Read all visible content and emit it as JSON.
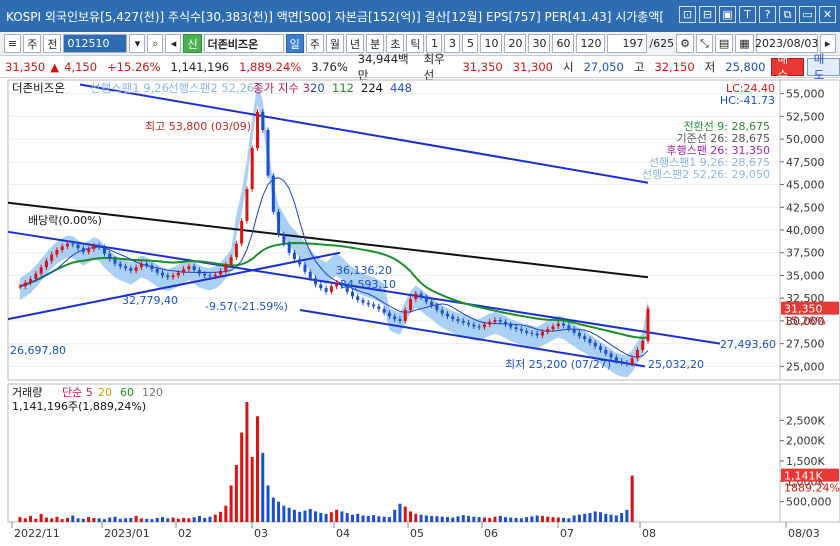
{
  "titlebar": {
    "text": "KOSPI 외국인보유[5,427(천)] 주식수[30,383(천)] 액면[500] 자본금[152(억)] 결산[12월] EPS[757] PER[41.43] 시가총액[",
    "buttons": [
      "⊡",
      "⊟",
      "▣",
      "T",
      "?",
      "⧉",
      "▭",
      "✕"
    ]
  },
  "toolbar": {
    "menu_btn": "≡",
    "type_select": "주",
    "prev_label": "전",
    "code": "012510",
    "new_label": "신",
    "name": "더존비즈온",
    "periods": [
      "일",
      "주",
      "월",
      "년",
      "분",
      "초",
      "틱"
    ],
    "selected_period": "일",
    "intervals": [
      "1",
      "3",
      "5",
      "10",
      "20",
      "30",
      "60",
      "120"
    ],
    "count": "197",
    "total": "/625",
    "date": "2023/08/03"
  },
  "quote": {
    "price": "31,350",
    "arrow": "▲",
    "change": "4,150",
    "change_pct": "+15.26%",
    "volume": "1,141,196",
    "volume_ratio": "1,889.24%",
    "turnover": "3.76%",
    "amount": "34,944백만",
    "best_ask_label": "최우선",
    "best_ask": "31,350",
    "best_bid": "31,300",
    "open_label": "시",
    "open": "27,050",
    "high_label": "고",
    "high": "32,150",
    "low_label": "저",
    "low": "25,800",
    "buy_label": "매수",
    "sell_label": "매도"
  },
  "chart_data": {
    "type": "line",
    "title": "더존비즈온",
    "legend_top": [
      {
        "name": "선행스팬1 9,26",
        "color": "#8ab6e8"
      },
      {
        "name": "선행스팬2 52,26",
        "color": "#8ab6e8"
      },
      {
        "name": "종가 지수 3",
        "color": "#c2185b"
      },
      {
        "name": "20",
        "color": "#1f3fd6"
      },
      {
        "name": "112",
        "color": "#1a8f2a"
      },
      {
        "name": "224",
        "color": "#111"
      },
      {
        "name": "448",
        "color": "#2a4ad8"
      }
    ],
    "ichimoku_legend": [
      {
        "text": "전환선 9: 28,675",
        "color": "#2a8a3c"
      },
      {
        "text": "기준선 26: 28,675",
        "color": "#555"
      },
      {
        "text": "후행스팬 26: 31,350",
        "color": "#9c27b0"
      },
      {
        "text": "선행스팬1 9,26: 28,675",
        "color": "#8ab6e8"
      },
      {
        "text": "선행스팬2 52,26: 29,050",
        "color": "#8ab6e8"
      }
    ],
    "lc_label": "LC:24.40",
    "hc_label": "HC:-41.73",
    "y_ticks": [
      "55,000",
      "52,500",
      "50,000",
      "47,500",
      "45,000",
      "42,500",
      "40,000",
      "37,500",
      "35,000",
      "32,500",
      "30,000",
      "27,500",
      "25,000"
    ],
    "ylim": [
      23500,
      56500
    ],
    "current_price_tag": "31,350",
    "current_pct_tag": "15.26%",
    "x_labels": [
      "2022/11",
      "2023/01",
      "02",
      "03",
      "04",
      "05",
      "06",
      "07",
      "08",
      "08/03"
    ],
    "annotations": {
      "high": "최고 53,800 (03/09)",
      "low": "최저 25,200 (07/27)",
      "dividend": "배당락(0.00%)",
      "a1": "32,779,40",
      "a2": "26,697,80",
      "a3": "-9.57(-21.59%)",
      "a4": "36,136,20",
      "a5": "34,593,10",
      "a6": "27,493,60",
      "a7": "25,032,20"
    },
    "closes": [
      33800,
      34200,
      34600,
      35200,
      35900,
      36600,
      37300,
      37800,
      38200,
      38500,
      38400,
      38000,
      37600,
      37900,
      38300,
      38100,
      37400,
      36800,
      36300,
      36000,
      35800,
      35500,
      35900,
      36300,
      36100,
      35700,
      35300,
      35000,
      34800,
      35000,
      35300,
      35700,
      36000,
      35600,
      35200,
      35000,
      34900,
      35100,
      35500,
      36200,
      37000,
      38500,
      41000,
      44500,
      49000,
      53000,
      51000,
      46000,
      42000,
      39500,
      38500,
      37500,
      36800,
      36200,
      35400,
      34700,
      34000,
      33600,
      33200,
      33800,
      34200,
      33800,
      33200,
      32700,
      32300,
      32000,
      31800,
      31600,
      31300,
      30900,
      30500,
      30200,
      30000,
      31200,
      32400,
      33000,
      32600,
      32100,
      31700,
      31200,
      30800,
      30500,
      30200,
      30000,
      29800,
      29600,
      29400,
      29300,
      29600,
      29900,
      30100,
      29900,
      29600,
      29300,
      29100,
      28900,
      28700,
      28600,
      28400,
      28800,
      29100,
      29400,
      29700,
      29500,
      29100,
      28700,
      28300,
      28000,
      27600,
      27200,
      26800,
      26400,
      26000,
      25600,
      25400,
      25300,
      25900,
      26800,
      27800,
      31350
    ],
    "volume": {
      "title": "거래량",
      "legend": [
        {
          "name": "단순 5",
          "color": "#c2185b"
        },
        {
          "name": "20",
          "color": "#c9a400"
        },
        {
          "name": "60",
          "color": "#1a8f2a"
        },
        {
          "name": "120",
          "color": "#777"
        }
      ],
      "current": "1,141,196주(1,889,24%)",
      "y_ticks": [
        "2,500K",
        "2,000K",
        "1,500K",
        "1,000K",
        "500,000"
      ],
      "ylim": [
        0,
        3000000
      ],
      "tag_value": "1,141K",
      "tag_pct": "1889.24%",
      "values": [
        120,
        90,
        150,
        80,
        200,
        110,
        90,
        130,
        70,
        100,
        160,
        90,
        80,
        120,
        100,
        90,
        70,
        110,
        130,
        80,
        90,
        100,
        150,
        90,
        80,
        70,
        100,
        120,
        90,
        110,
        80,
        100,
        90,
        120,
        150,
        100,
        130,
        180,
        250,
        400,
        900,
        1400,
        2200,
        2950,
        1600,
        2600,
        1700,
        900,
        600,
        500,
        400,
        350,
        300,
        250,
        280,
        320,
        260,
        220,
        200,
        240,
        300,
        260,
        220,
        180,
        200,
        160,
        150,
        170,
        140,
        130,
        120,
        300,
        450,
        380,
        260,
        200,
        180,
        160,
        150,
        140,
        130,
        120,
        110,
        140,
        170,
        150,
        130,
        120,
        110,
        100,
        130,
        150,
        120,
        110,
        100,
        90,
        120,
        140,
        160,
        150,
        130,
        120,
        110,
        100,
        90,
        160,
        180,
        200,
        220,
        260,
        240,
        200,
        180,
        160,
        220,
        300,
        1141
      ]
    }
  }
}
